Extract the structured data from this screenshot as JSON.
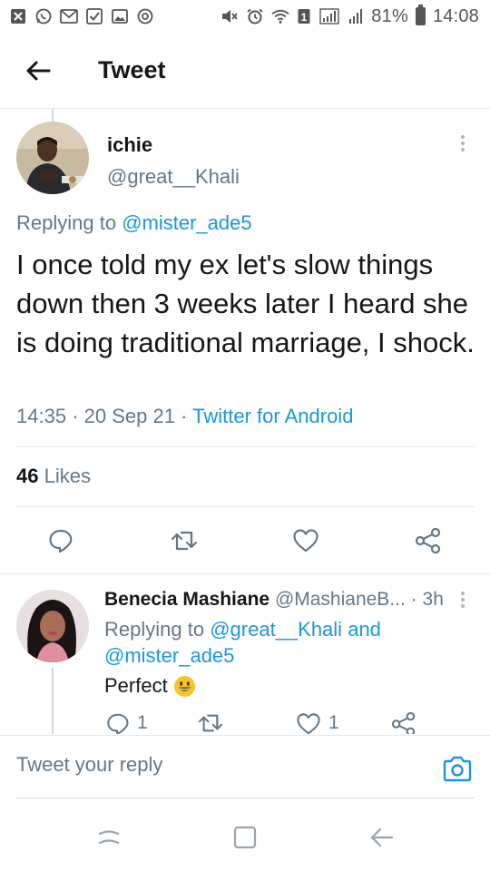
{
  "status_bar": {
    "battery_percent": "81%",
    "time": "14:08",
    "notification_icons": [
      "close-box-icon",
      "whatsapp-icon",
      "gmail-icon",
      "checkbox-icon",
      "image-icon",
      "chrome-icon"
    ],
    "system_icons": [
      "mute-icon",
      "alarm-icon",
      "wifi-icon",
      "sim1-icon",
      "signal-icon",
      "signal-icon",
      "battery-icon"
    ],
    "sim_label": "1"
  },
  "header": {
    "title": "Tweet"
  },
  "main_tweet": {
    "author_name": "ichie",
    "author_handle": "@great__Khali",
    "replying_prefix": "Replying to",
    "replying_to": "@mister_ade5",
    "text": "I once told my ex let's slow things down then 3 weeks later I heard she is doing traditional marriage, I shock.",
    "time": "14:35",
    "date": "20 Sep 21",
    "separator": "·",
    "source": "Twitter for Android",
    "likes_count": "46",
    "likes_label": "Likes"
  },
  "reply_tweet": {
    "author_name": "Benecia Mashiane",
    "author_handle": "@MashianeB...",
    "separator": "·",
    "age": "3h",
    "replying_prefix": "Replying to",
    "replying_to_1": "@great__Khali",
    "replying_and": "and",
    "replying_to_2": "@mister_ade5",
    "text": "Perfect",
    "emoji": "grinning-face",
    "reply_count": "1",
    "like_count": "1"
  },
  "compose": {
    "placeholder": "Tweet your reply"
  },
  "colors": {
    "accent": "#1b95e0",
    "text": "#14171a",
    "secondary": "#657786",
    "divider": "#e1e8ed"
  }
}
